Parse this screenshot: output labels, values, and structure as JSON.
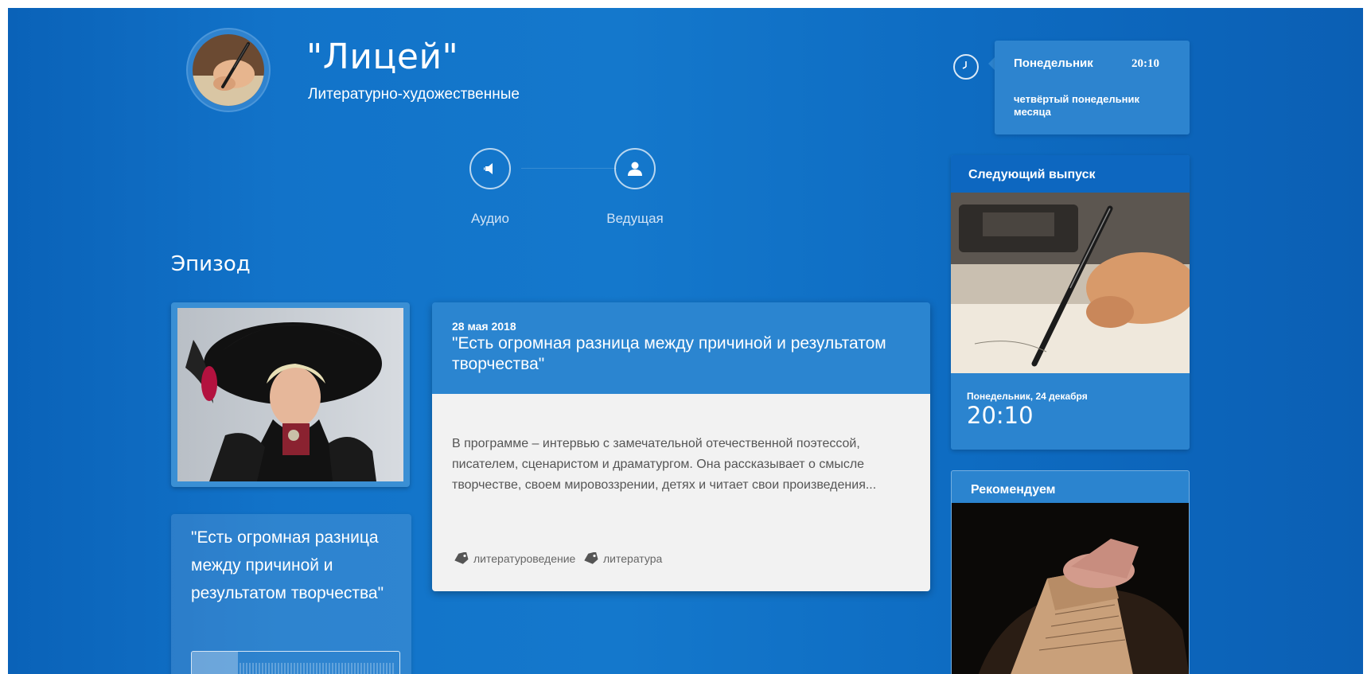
{
  "program": {
    "title": "\"Лицей\"",
    "subtitle": "Литературно-художественные"
  },
  "nav": {
    "audio_label": "Аудио",
    "host_label": "Ведущая"
  },
  "section": {
    "title": "Эпизод"
  },
  "episode": {
    "date": "28 мая 2018",
    "title": "\"Есть огромная разница между причиной и результатом творчества\"",
    "description": "В программе – интервью с замечательной отечественной поэтессой, писателем, сценаристом и драматургом. Она рассказывает о смысле творчестве, своем мировоззрении, детях и читает свои произведения...",
    "tags": [
      "литературоведение",
      "литература"
    ],
    "quote": "\"Есть огромная разница между причиной и результатом творчества\""
  },
  "schedule": {
    "day": "Понедельник",
    "time": "20:10",
    "note": "четвёртый понедельник месяца"
  },
  "next_release": {
    "title": "Следующий выпуск",
    "date": "Понедельник, 24 декабря",
    "time": "20:10"
  },
  "recommend": {
    "title": "Рекомендуем"
  },
  "colors": {
    "background": "#1273c9",
    "card_header": "#2b85d0",
    "card_body": "#f2f2f2"
  }
}
